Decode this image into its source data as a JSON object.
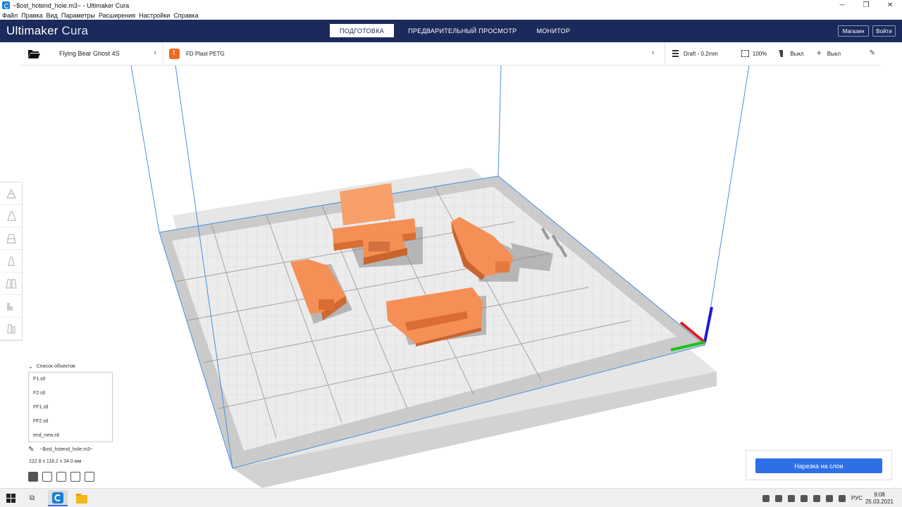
{
  "window": {
    "title": "~$ost_hotend_hole.m3~ - Ultimaker Cura"
  },
  "menu": [
    "Файл",
    "Правка",
    "Вид",
    "Параметры",
    "Расширения",
    "Настройки",
    "Справка"
  ],
  "header": {
    "brand": "Ultimaker",
    "brand2": "Cura",
    "stages": [
      "ПОДГОТОВКА",
      "ПРЕДВАРИТЕЛЬНЫЙ ПРОСМОТР",
      "МОНИТОР"
    ],
    "store_label": "Магазин",
    "login_label": "Войти"
  },
  "toolbar": {
    "printer": "Flying Bear Ghost 4S",
    "material": "FD Plast PETG",
    "profile": "Draft - 0.2mm",
    "infill": "100%",
    "support": "Выкл",
    "adhesion": "Выкл"
  },
  "object_list": {
    "title": "Список объектов",
    "items": [
      "F1.stl",
      "F2.stl",
      "FF1.stl",
      "FF2.stl",
      "end_new.stl"
    ]
  },
  "project": {
    "name": "~$ost_hotend_hole.m3~",
    "dimensions": "122.8 x 118.2 x 34.0 мм"
  },
  "slice": {
    "button_label": "Нарезка на слои"
  },
  "taskbar": {
    "lang": "РУС",
    "time": "9:08",
    "date": "25.03.2021"
  },
  "colors": {
    "header": "#1b2a5a",
    "model": "#f5894a",
    "slice_button": "#2e6fe6",
    "build_volume_lines": "#4a8fe0"
  },
  "icons": [
    "folder-open-icon",
    "chevron-left-icon",
    "material-warning-icon",
    "profile-icon",
    "infill-icon",
    "support-icon",
    "adhesion-icon",
    "pencil-icon",
    "move-icon",
    "scale-icon",
    "rotate-icon",
    "mirror-icon",
    "per-model-settings-icon",
    "support-blocker-icon",
    "windows-start-icon",
    "task-view-icon",
    "cura-app-icon",
    "explorer-icon"
  ]
}
